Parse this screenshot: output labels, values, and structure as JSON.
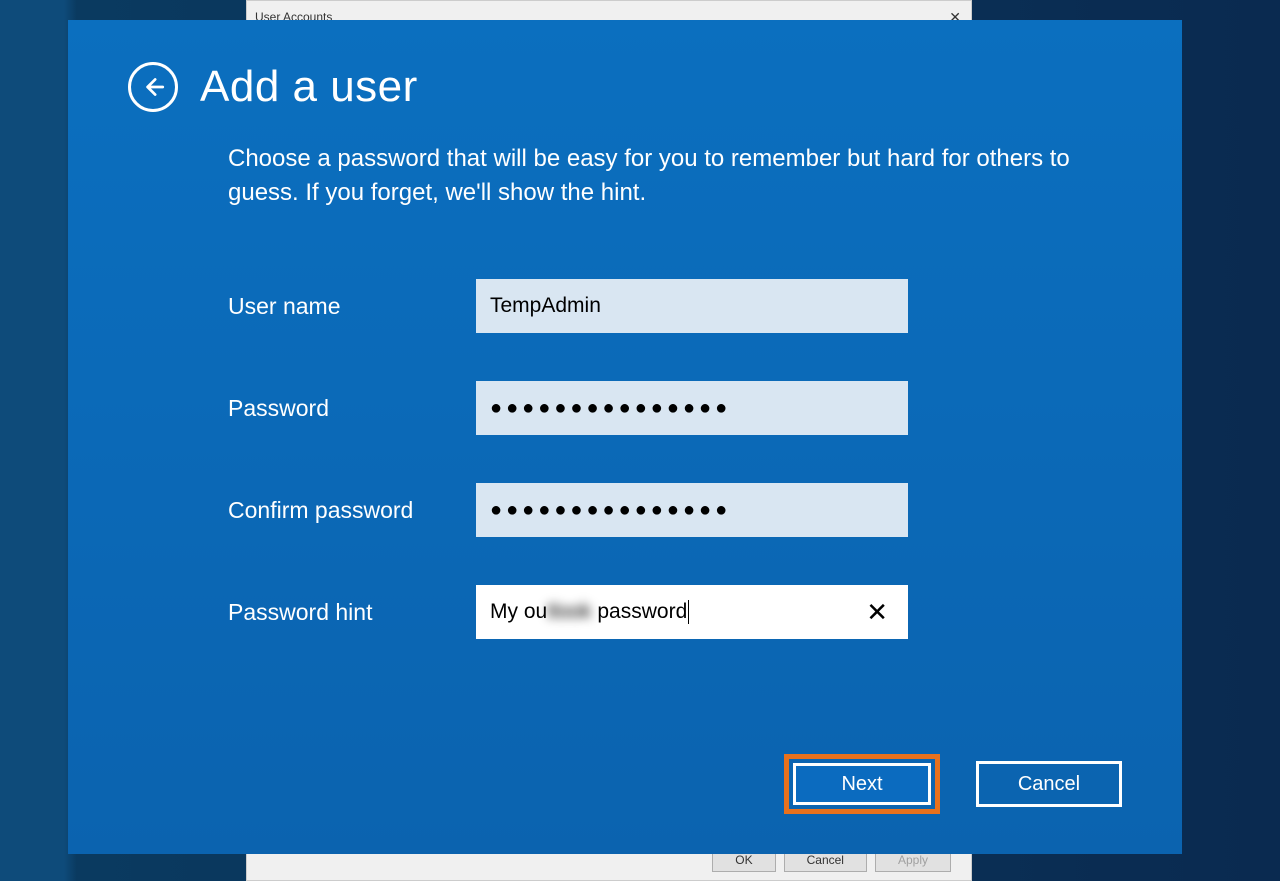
{
  "background_dialog": {
    "title": "User Accounts",
    "buttons": {
      "ok": "OK",
      "cancel": "Cancel",
      "apply": "Apply"
    }
  },
  "modal": {
    "title": "Add a user",
    "subtitle": "Choose a password that will be easy for you to remember but hard for others to guess. If you forget, we'll show the hint.",
    "fields": {
      "username": {
        "label": "User name",
        "value": "TempAdmin"
      },
      "password": {
        "label": "Password",
        "value": "●●●●●●●●●●●●●●●"
      },
      "confirm": {
        "label": "Confirm password",
        "value": "●●●●●●●●●●●●●●●"
      },
      "hint": {
        "label": "Password hint",
        "prefix": "My ou",
        "blurred": "tlook",
        "suffix": " password",
        "clear_icon": "✕"
      }
    },
    "buttons": {
      "next": "Next",
      "cancel": "Cancel"
    }
  }
}
